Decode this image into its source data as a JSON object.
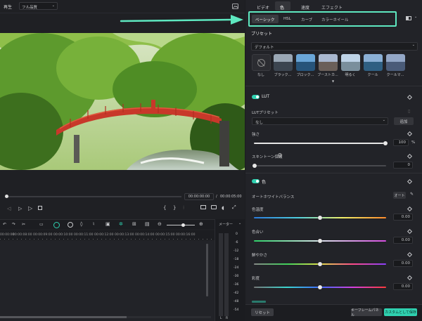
{
  "topbar": {
    "play_label": "再生",
    "quality": "フル品質"
  },
  "player": {
    "current_time": "00:00:00:00",
    "separator": "/",
    "total_time": "00:00:05:00"
  },
  "timeline": {
    "ruler": [
      "00:00:00",
      "00:00:08:00",
      "00:00:09:00",
      "00:00:10:00",
      "00:00:11:00",
      "00:00:12:00",
      "00:00:13:00",
      "00:00:14:00",
      "00:00:15:00",
      "00:00:16:00"
    ],
    "meter_label": "メーター",
    "meter_scale": [
      "0",
      "-6",
      "-12",
      "-18",
      "-24",
      "-30",
      "-36",
      "-42",
      "-48",
      "-54"
    ],
    "meter_lr": [
      "L",
      "R"
    ]
  },
  "tabs": {
    "video": "ビデオ",
    "color": "色",
    "speed": "速度",
    "effect": "エフェクト"
  },
  "subtabs": {
    "basic": "ベーシック",
    "hsl": "HSL",
    "curve": "カーブ",
    "wheel": "カラーホイール"
  },
  "presets": {
    "title": "プリセット",
    "dropdown": "デフォルト",
    "items": [
      "なし",
      "ブラック...",
      "ブロック...",
      "ブーストカ...",
      "明るく",
      "クール",
      "クールマ..."
    ]
  },
  "lut": {
    "title": "LUT",
    "preset_label": "LUTプリセット",
    "preset_value": "なし",
    "add_button": "追加",
    "strength_label": "強さ",
    "strength_value": "100",
    "strength_unit": "%",
    "skin_label": "スキントーン保護",
    "skin_value": "0"
  },
  "color": {
    "title": "色",
    "awb_label": "オートホワイトバランス",
    "auto_button": "オート",
    "sliders": [
      {
        "label": "色温度",
        "value": "0.00",
        "level": 0.5
      },
      {
        "label": "色合い",
        "value": "0.00",
        "level": 0.5
      },
      {
        "label": "鮮やかさ",
        "value": "0.00",
        "level": 0.5
      },
      {
        "label": "彩度",
        "value": "0.00",
        "level": 0.5
      }
    ]
  },
  "footer": {
    "reset": "リセット",
    "keyframe": "キーフレームパネル",
    "save_custom": "カスタムとして保存"
  },
  "colors": {
    "accent": "#2fd1b0",
    "highlight_border": "#5ee8c0",
    "arrow": "#5ee8c0"
  }
}
